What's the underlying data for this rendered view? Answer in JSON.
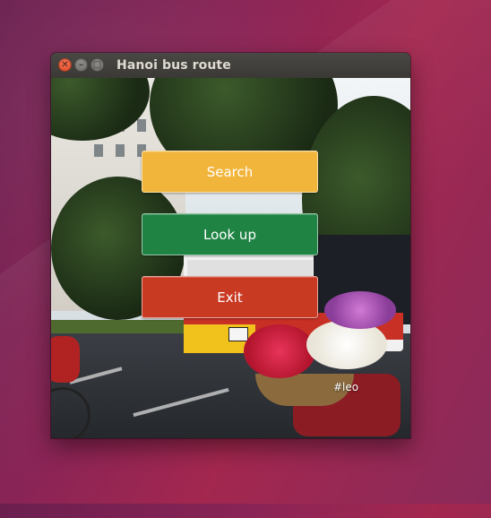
{
  "window": {
    "title": "Hanoi bus route",
    "controls": {
      "close_glyph": "✕",
      "minimize_glyph": "–",
      "maximize_glyph": "□"
    }
  },
  "buttons": {
    "search_label": "Search",
    "lookup_label": "Look up",
    "exit_label": "Exit"
  },
  "background": {
    "watermark": "#leo"
  },
  "colors": {
    "search": "#f1b53b",
    "lookup": "#1f8443",
    "exit": "#c93a23",
    "close_button": "#e3572f"
  }
}
